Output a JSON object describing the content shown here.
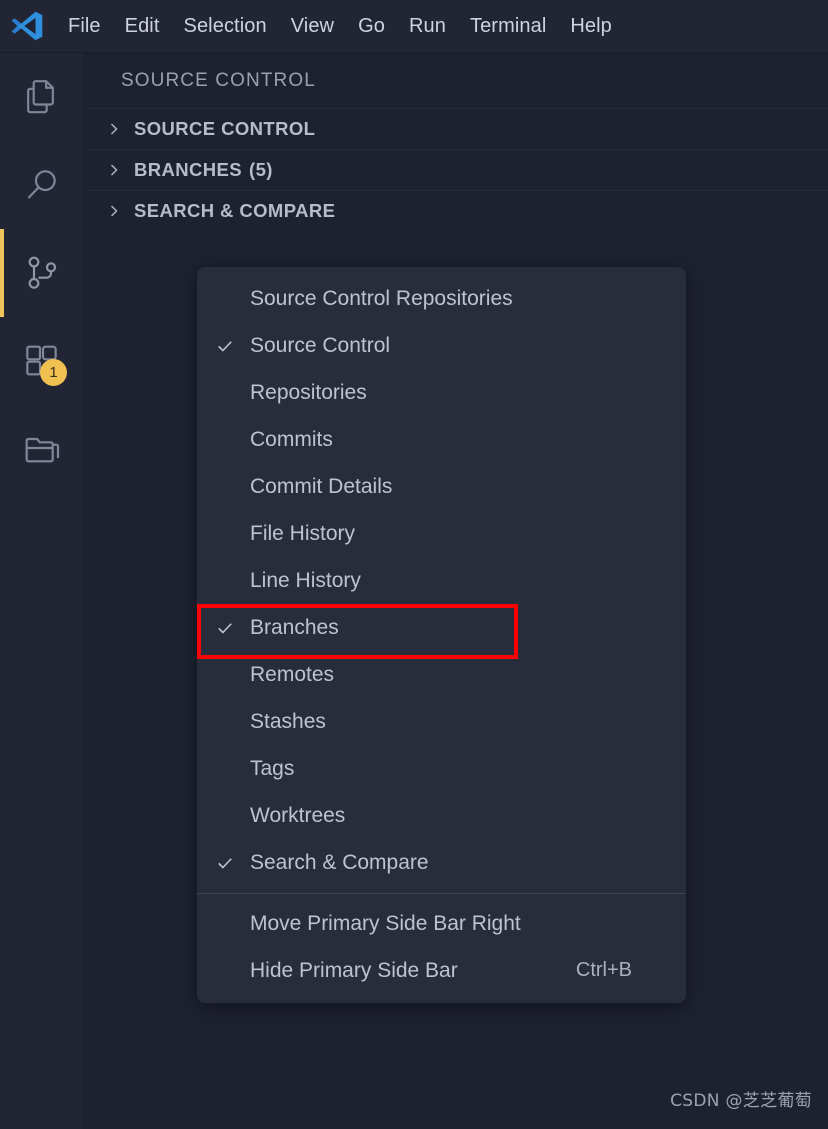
{
  "window": {
    "app": "Visual Studio Code",
    "logo_icon": "vscode-logo-icon"
  },
  "menubar": {
    "items": [
      {
        "label": "File"
      },
      {
        "label": "Edit"
      },
      {
        "label": "Selection"
      },
      {
        "label": "View"
      },
      {
        "label": "Go"
      },
      {
        "label": "Run"
      },
      {
        "label": "Terminal"
      },
      {
        "label": "Help"
      }
    ]
  },
  "activitybar": {
    "items": [
      {
        "name": "explorer",
        "icon": "files-icon",
        "active": false,
        "badge": ""
      },
      {
        "name": "search",
        "icon": "search-icon",
        "active": false,
        "badge": ""
      },
      {
        "name": "source-control",
        "icon": "source-control-icon",
        "active": true,
        "badge": ""
      },
      {
        "name": "extensions",
        "icon": "extensions-icon",
        "active": false,
        "badge": "1"
      },
      {
        "name": "explorer-workspace",
        "icon": "folder-icon",
        "active": false,
        "badge": ""
      }
    ],
    "active_indicator_color": "#f2c55c",
    "badge_color": "#f0c050"
  },
  "sidebar": {
    "title": "SOURCE CONTROL",
    "sections": [
      {
        "label": "SOURCE CONTROL",
        "count": "",
        "expanded": false
      },
      {
        "label": "BRANCHES",
        "count": "(5)",
        "expanded": false
      },
      {
        "label": "SEARCH & COMPARE",
        "count": "",
        "expanded": false
      }
    ]
  },
  "context_menu": {
    "items": [
      {
        "label": "Source Control Repositories",
        "checked": false,
        "shortcut": ""
      },
      {
        "label": "Source Control",
        "checked": true,
        "shortcut": ""
      },
      {
        "label": "Repositories",
        "checked": false,
        "shortcut": ""
      },
      {
        "label": "Commits",
        "checked": false,
        "shortcut": ""
      },
      {
        "label": "Commit Details",
        "checked": false,
        "shortcut": ""
      },
      {
        "label": "File History",
        "checked": false,
        "shortcut": ""
      },
      {
        "label": "Line History",
        "checked": false,
        "shortcut": ""
      },
      {
        "label": "Branches",
        "checked": true,
        "shortcut": "",
        "highlighted": true
      },
      {
        "label": "Remotes",
        "checked": false,
        "shortcut": ""
      },
      {
        "label": "Stashes",
        "checked": false,
        "shortcut": ""
      },
      {
        "label": "Tags",
        "checked": false,
        "shortcut": ""
      },
      {
        "label": "Worktrees",
        "checked": false,
        "shortcut": ""
      },
      {
        "label": "Search & Compare",
        "checked": true,
        "shortcut": ""
      }
    ],
    "footer_items": [
      {
        "label": "Move Primary Side Bar Right",
        "shortcut": ""
      },
      {
        "label": "Hide Primary Side Bar",
        "shortcut": "Ctrl+B"
      }
    ],
    "highlight_color": "#fe0000"
  },
  "watermark": {
    "text": "CSDN @芝芝葡萄"
  }
}
